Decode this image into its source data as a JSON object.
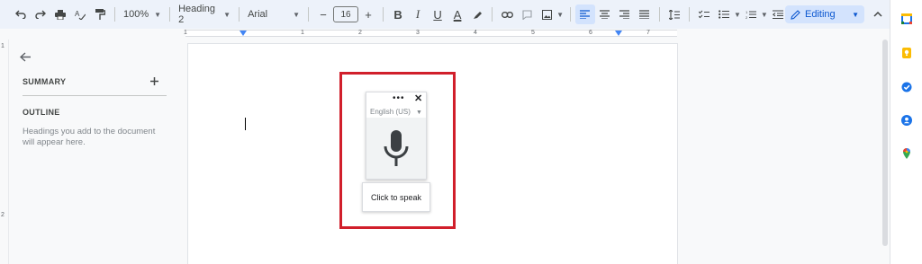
{
  "toolbar": {
    "zoom": "100%",
    "style": "Heading 2",
    "font": "Arial",
    "font_size": "16",
    "bold": "B",
    "italic": "I",
    "underline": "U",
    "text_color": "A",
    "mode": "Editing"
  },
  "ruler": {
    "numbers": [
      "1",
      "1",
      "2",
      "3",
      "4",
      "5",
      "6",
      "7"
    ],
    "vertical_numbers": [
      "1",
      "2"
    ]
  },
  "outline": {
    "summary": "SUMMARY",
    "outline": "OUTLINE",
    "hint": "Headings you add to the document will appear here."
  },
  "voice": {
    "language": "English (US)",
    "tooltip": "Click to speak"
  },
  "colors": {
    "toolbar_bg": "#edf2fa",
    "editing_bg": "#d3e3fd",
    "accent": "#0b57d0",
    "highlight_border": "#d11f2b"
  },
  "side_icons": [
    "calendar-icon",
    "keep-icon",
    "tasks-icon",
    "contacts-icon",
    "maps-icon"
  ]
}
